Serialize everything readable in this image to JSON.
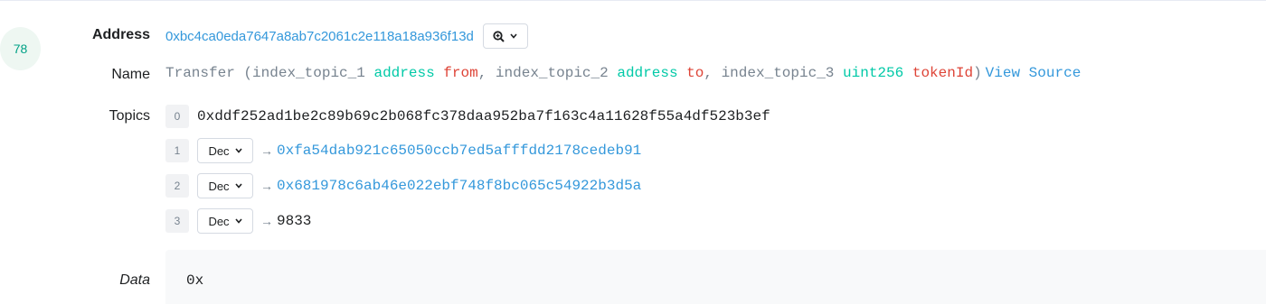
{
  "log": {
    "index": "78"
  },
  "labels": {
    "address": "Address",
    "name": "Name",
    "topics": "Topics",
    "data": "Data"
  },
  "address": {
    "value": "0xbc4ca0eda7647a8ab7c2061c2e118a18a936f13d",
    "zoom_icon": "zoom-in-icon",
    "dropdown_icon": "chevron-down-icon"
  },
  "event": {
    "name": "Transfer",
    "open_paren": "(",
    "close_paren": ")",
    "separator": ", ",
    "params": [
      {
        "indexed": "index_topic_1",
        "type": "address",
        "name": "from"
      },
      {
        "indexed": "index_topic_2",
        "type": "address",
        "name": "to"
      },
      {
        "indexed": "index_topic_3",
        "type": "uint256",
        "name": "tokenId"
      }
    ],
    "view_source": "View Source"
  },
  "topics": [
    {
      "index": "0",
      "value": "0xddf252ad1be2c89b69c2b068fc378daa952ba7f163c4a11628f55a4df523b3ef"
    },
    {
      "index": "1",
      "format": "Dec",
      "arrow": "→",
      "value": "0xfa54dab921c65050ccb7ed5afffdd2178cedeb91"
    },
    {
      "index": "2",
      "format": "Dec",
      "arrow": "→",
      "value": "0x681978c6ab46e022ebf748f8bc065c54922b3d5a"
    },
    {
      "index": "3",
      "format": "Dec",
      "arrow": "→",
      "value": "9833"
    }
  ],
  "data": {
    "value": "0x"
  },
  "colors": {
    "link": "#3498db",
    "type": "#00c9a7",
    "param": "#de4437",
    "muted": "#77838f",
    "index_badge": "#00a186"
  }
}
